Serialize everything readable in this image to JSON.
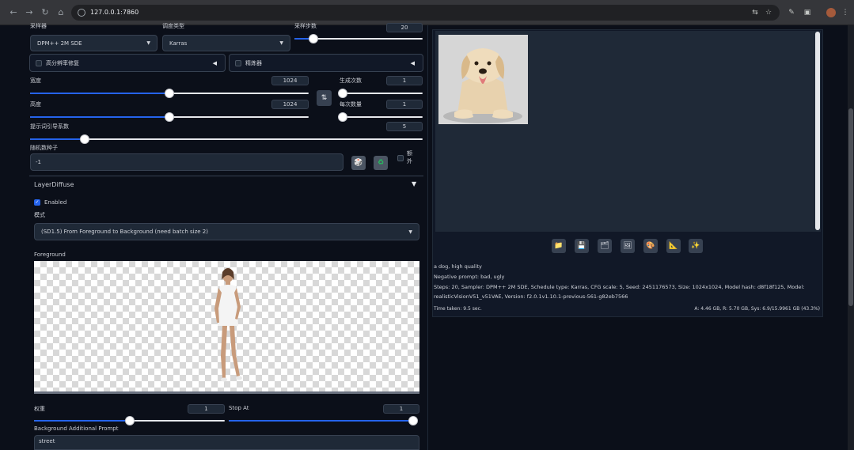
{
  "browser": {
    "url": "127.0.0.1:7860",
    "nav_icons": [
      "back-icon",
      "forward-icon",
      "reload-icon",
      "home-icon"
    ]
  },
  "sampling": {
    "sampler_label": "采样器",
    "sampler_value": "DPM++ 2M SDE",
    "schedule_label": "调度类型",
    "schedule_value": "Karras",
    "steps_label": "采样步数",
    "steps_value": "20",
    "steps_fraction": 0.15
  },
  "accordions": {
    "hires": "高分辨率修复",
    "refiner": "精炼器"
  },
  "size": {
    "width_label": "宽度",
    "width_value": "1024",
    "width_fraction": 0.5,
    "height_label": "高度",
    "height_value": "1024",
    "height_fraction": 0.5,
    "swap_icon": "⇅",
    "batch_count_label": "生成次数",
    "batch_count_value": "1",
    "batch_size_label": "每次数量",
    "batch_size_value": "1"
  },
  "cfg": {
    "label": "提示词引导系数",
    "value": "5",
    "fraction": 0.14
  },
  "seed": {
    "label": "随机数种子",
    "value": "-1",
    "extra_label": "额外"
  },
  "layerdiffuse": {
    "title": "LayerDiffuse",
    "enabled_label": "Enabled",
    "method_label": "模式",
    "method_value": "(SD1.5) From Foreground to Background (need batch size 2)",
    "foreground_label": "Foreground",
    "weight_label": "权重",
    "weight_value": "1",
    "weight_fraction": 0.5,
    "stop_at_label": "Stop At",
    "stop_at_value": "1",
    "stop_at_fraction": 1.0,
    "bg_prompt_label": "Background Additional Prompt",
    "bg_prompt_value": "street"
  },
  "output": {
    "toolbar_icons": [
      "📁",
      "💾",
      "🗂",
      "🖼",
      "🎨",
      "📐",
      "✨"
    ],
    "prompt": "a dog, high quality",
    "negative": "Negative prompt: bad, ugly",
    "params_line1": "Steps: 20, Sampler: DPM++ 2M SDE, Schedule type: Karras, CFG scale: 5, Seed: 2451176573, Size: 1024x1024, Model hash: d8f18f125, Model:",
    "params_line2": "realisticVisionV51_v51VAE, Version: f2.0.1v1.10.1-previous-561-g82eb7566",
    "time_taken": "Time taken: 9.5 sec.",
    "vram": "A: 4.46 GB, R: 5.70 GB, Sys: 6.9/15.9961 GB (43.3%)"
  }
}
